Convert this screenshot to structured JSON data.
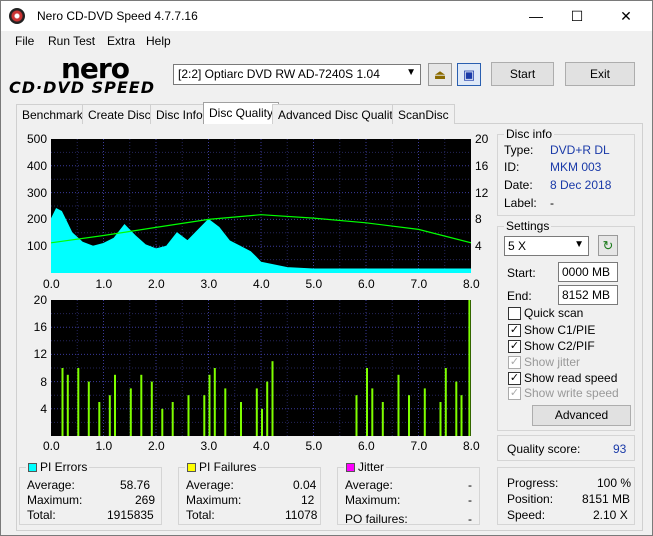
{
  "window": {
    "title": "Nero CD-DVD Speed 4.7.7.16",
    "minimize": "—",
    "maximize": "☐",
    "close": "✕"
  },
  "menu": [
    "File",
    "Run Test",
    "Extra",
    "Help"
  ],
  "logo": {
    "line1": "nero",
    "line2": "CD·DVD SPEED"
  },
  "toolbar": {
    "drive": "[2:2]   Optiarc DVD RW AD-7240S 1.04",
    "start": "Start",
    "exit": "Exit",
    "eject_icon": "eject-icon",
    "save_icon": "save-icon"
  },
  "tabs": [
    "Benchmark",
    "Create Disc",
    "Disc Info",
    "Disc Quality",
    "Advanced Disc Quality",
    "ScanDisc"
  ],
  "active_tab": "Disc Quality",
  "disc_info": {
    "title": "Disc info",
    "type_label": "Type:",
    "type": "DVD+R DL",
    "id_label": "ID:",
    "id": "MKM 003",
    "date_label": "Date:",
    "date": "8 Dec 2018",
    "label_label": "Label:",
    "label": "-"
  },
  "settings": {
    "title": "Settings",
    "speed": "5 X",
    "start_label": "Start:",
    "start": "0000 MB",
    "end_label": "End:",
    "end": "8152 MB",
    "quick_scan": "Quick scan",
    "show_c1": "Show C1/PIE",
    "show_c2": "Show C2/PIF",
    "show_jitter": "Show jitter",
    "show_read": "Show read speed",
    "show_write": "Show write speed",
    "advanced": "Advanced"
  },
  "quality": {
    "label": "Quality score:",
    "value": "93"
  },
  "progress": {
    "progress_label": "Progress:",
    "progress": "100 %",
    "position_label": "Position:",
    "position": "8151 MB",
    "speed_label": "Speed:",
    "speed": "2.10 X"
  },
  "pi_errors": {
    "title": "PI Errors",
    "avg_label": "Average:",
    "avg": "58.76",
    "max_label": "Maximum:",
    "max": "269",
    "total_label": "Total:",
    "total": "1915835",
    "color": "#00ffff"
  },
  "pi_failures": {
    "title": "PI Failures",
    "avg_label": "Average:",
    "avg": "0.04",
    "max_label": "Maximum:",
    "max": "12",
    "total_label": "Total:",
    "total": "11078",
    "color": "#ffff00"
  },
  "jitter": {
    "title": "Jitter",
    "avg_label": "Average:",
    "avg": "-",
    "max_label": "Maximum:",
    "max": "-",
    "po_label": "PO failures:",
    "po": "-",
    "color": "#ff00ff"
  },
  "chart_data": [
    {
      "type": "area",
      "x_ticks": [
        "0.0",
        "1.0",
        "2.0",
        "3.0",
        "4.0",
        "5.0",
        "6.0",
        "7.0",
        "8.0"
      ],
      "y_left_ticks": [
        "500",
        "400",
        "300",
        "200",
        "100"
      ],
      "y_right_ticks": [
        "20",
        "16",
        "12",
        "8",
        "4"
      ],
      "ylim_left": [
        0,
        500
      ],
      "ylim_right": [
        0,
        20
      ],
      "xlim": [
        0,
        8
      ],
      "series": [
        {
          "color": "#00ffff",
          "x": [
            0.0,
            0.1,
            0.2,
            0.3,
            0.4,
            0.6,
            0.8,
            1.0,
            1.2,
            1.4,
            1.6,
            1.8,
            2.0,
            2.2,
            2.4,
            2.6,
            2.8,
            3.0,
            3.2,
            3.4,
            3.6,
            3.8,
            3.9,
            4.0,
            4.5,
            5.0,
            6.0,
            7.0,
            8.0
          ],
          "values": [
            200,
            240,
            230,
            190,
            150,
            115,
            100,
            110,
            130,
            180,
            140,
            105,
            90,
            100,
            150,
            120,
            160,
            200,
            170,
            120,
            100,
            80,
            60,
            40,
            20,
            15,
            15,
            15,
            15
          ]
        },
        {
          "color": "#00ff00",
          "x": [
            0,
            1,
            2,
            3,
            4,
            5,
            6,
            7,
            8
          ],
          "values_right": [
            4.5,
            5.6,
            6.8,
            8.0,
            8.7,
            8.2,
            7.5,
            6.5,
            4.5
          ]
        }
      ]
    },
    {
      "type": "bar",
      "x_ticks": [
        "0.0",
        "1.0",
        "2.0",
        "3.0",
        "4.0",
        "5.0",
        "6.0",
        "7.0",
        "8.0"
      ],
      "y_ticks": [
        "20",
        "16",
        "12",
        "8",
        "4"
      ],
      "ylim": [
        0,
        20
      ],
      "xlim": [
        0,
        8
      ],
      "series": [
        {
          "color": "#7fff00",
          "x": [
            0.2,
            0.3,
            0.5,
            0.7,
            0.9,
            1.1,
            1.2,
            1.5,
            1.7,
            1.9,
            2.1,
            2.3,
            2.6,
            2.9,
            3.0,
            3.1,
            3.3,
            3.6,
            3.9,
            4.0,
            4.1,
            4.2,
            5.8,
            6.0,
            6.1,
            6.3,
            6.6,
            6.8,
            7.1,
            7.4,
            7.5,
            7.7,
            7.8,
            7.95
          ],
          "values": [
            10,
            9,
            10,
            8,
            5,
            6,
            9,
            7,
            9,
            8,
            4,
            5,
            6,
            6,
            9,
            10,
            7,
            5,
            7,
            4,
            8,
            11,
            6,
            10,
            7,
            5,
            9,
            6,
            7,
            5,
            10,
            8,
            6,
            20
          ]
        }
      ]
    }
  ]
}
